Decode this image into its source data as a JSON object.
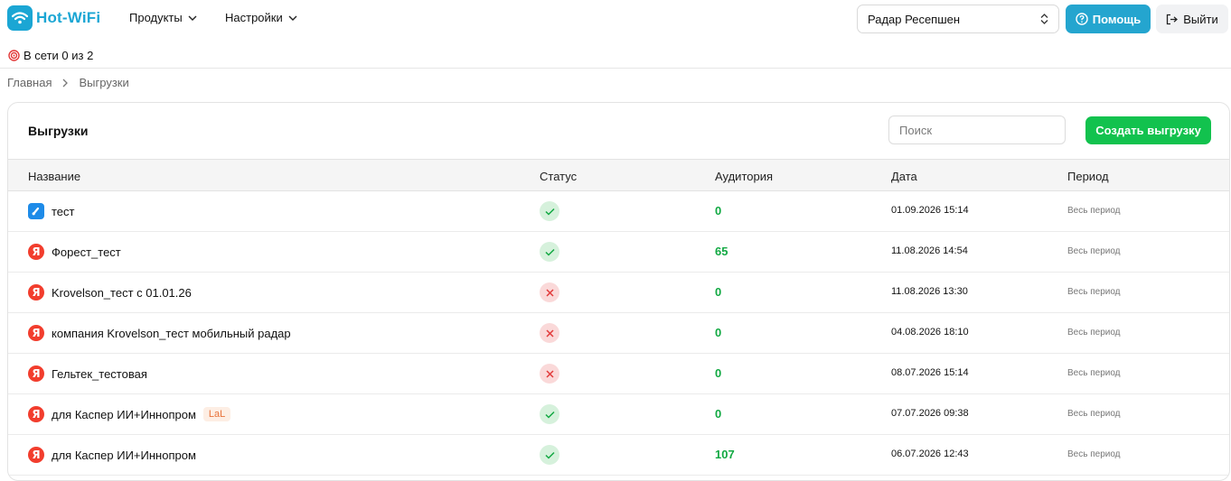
{
  "brand": {
    "name": "Hot-WiFi",
    "color": "#1ba6d4"
  },
  "nav": [
    {
      "label": "Продукты"
    },
    {
      "label": "Настройки"
    }
  ],
  "location_select": {
    "value": "Радар Ресепшен"
  },
  "help_button": {
    "label": "Помощь"
  },
  "logout_button": {
    "label": "Выйти"
  },
  "online_status": {
    "text": "В сети 0 из 2"
  },
  "breadcrumb": {
    "home": "Главная",
    "current": "Выгрузки"
  },
  "page": {
    "title": "Выгрузки",
    "search_placeholder": "Поиск",
    "create_button": "Создать выгрузку"
  },
  "table": {
    "columns": [
      "Название",
      "Статус",
      "Аудитория",
      "Дата",
      "Период"
    ],
    "rows": [
      {
        "source": "vk-icon",
        "name": "тест",
        "badge": "",
        "status": "success",
        "audience": "0",
        "date": "01.09.2026 15:14",
        "period": "Весь период"
      },
      {
        "source": "yandex-icon",
        "name": "Форест_тест",
        "badge": "",
        "status": "success",
        "audience": "65",
        "date": "11.08.2026 14:54",
        "period": "Весь период"
      },
      {
        "source": "yandex-icon",
        "name": "Krovelson_тест с 01.01.26",
        "badge": "",
        "status": "failed",
        "audience": "0",
        "date": "11.08.2026 13:30",
        "period": "Весь период"
      },
      {
        "source": "yandex-icon",
        "name": "компания Krovelson_тест мобильный радар",
        "badge": "",
        "status": "failed",
        "audience": "0",
        "date": "04.08.2026 18:10",
        "period": "Весь период"
      },
      {
        "source": "yandex-icon",
        "name": "Гельтек_тестовая",
        "badge": "",
        "status": "failed",
        "audience": "0",
        "date": "08.07.2026 15:14",
        "period": "Весь период"
      },
      {
        "source": "yandex-icon",
        "name": "для Каспер ИИ+Иннопром",
        "badge": "LaL",
        "status": "success",
        "audience": "0",
        "date": "07.07.2026 09:38",
        "period": "Весь период"
      },
      {
        "source": "yandex-icon",
        "name": "для Каспер ИИ+Иннопром",
        "badge": "",
        "status": "success",
        "audience": "107",
        "date": "06.07.2026 12:43",
        "period": "Весь период"
      }
    ]
  },
  "colors": {
    "accent_green": "#12c24e",
    "help_blue": "#24a5cf",
    "success": "#12a943",
    "error": "#e23b3b"
  },
  "icons": {
    "yandex_letter": "Я"
  }
}
